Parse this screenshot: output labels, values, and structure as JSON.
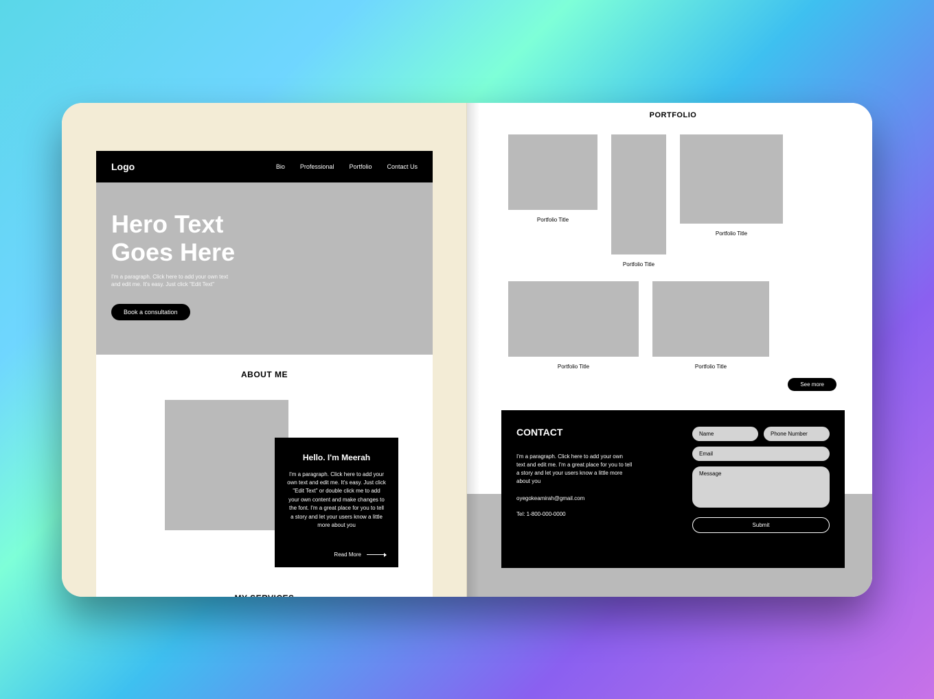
{
  "header": {
    "logo": "Logo",
    "nav": [
      "Bio",
      "Professional",
      "Portfolio",
      "Contact Us"
    ]
  },
  "hero": {
    "title_line1": "Hero Text",
    "title_line2": "Goes Here",
    "subtitle": "I'm a paragraph. Click here to add your own text and edit me. It's easy. Just click \"Edit Text\"",
    "cta": "Book a consultation"
  },
  "about": {
    "heading": "ABOUT ME",
    "card_title": "Hello. I'm Meerah",
    "card_body": "I'm a paragraph. Click here to add your own text and edit me. It's easy. Just click \"Edit Text\" or double click me to add your own content and make changes to the font. I'm a great place for you to tell a story and let your users know a little more about you",
    "read_more": "Read More"
  },
  "services": {
    "heading": "MY SERVICES"
  },
  "portfolio": {
    "heading": "PORTFOLIO",
    "items": [
      {
        "title": "Portfolio Title"
      },
      {
        "title": "Portfolio Title"
      },
      {
        "title": "Portfolio Title"
      },
      {
        "title": "Portfolio Title"
      },
      {
        "title": "Portfolio Title"
      }
    ],
    "see_more": "See more"
  },
  "contact": {
    "heading": "CONTACT",
    "blurb": "I'm a paragraph. Click here to add your own text and edit me. I'm a great place for you to tell a story and let your users know a little more about you",
    "email": "oyegokeamirah@gmail.com",
    "phone_label": "Tel: 1-800-000-0000",
    "form": {
      "name_placeholder": "Name",
      "phone_placeholder": "Phone Number",
      "email_placeholder": "Email",
      "message_placeholder": "Message",
      "submit_label": "Submit"
    }
  }
}
